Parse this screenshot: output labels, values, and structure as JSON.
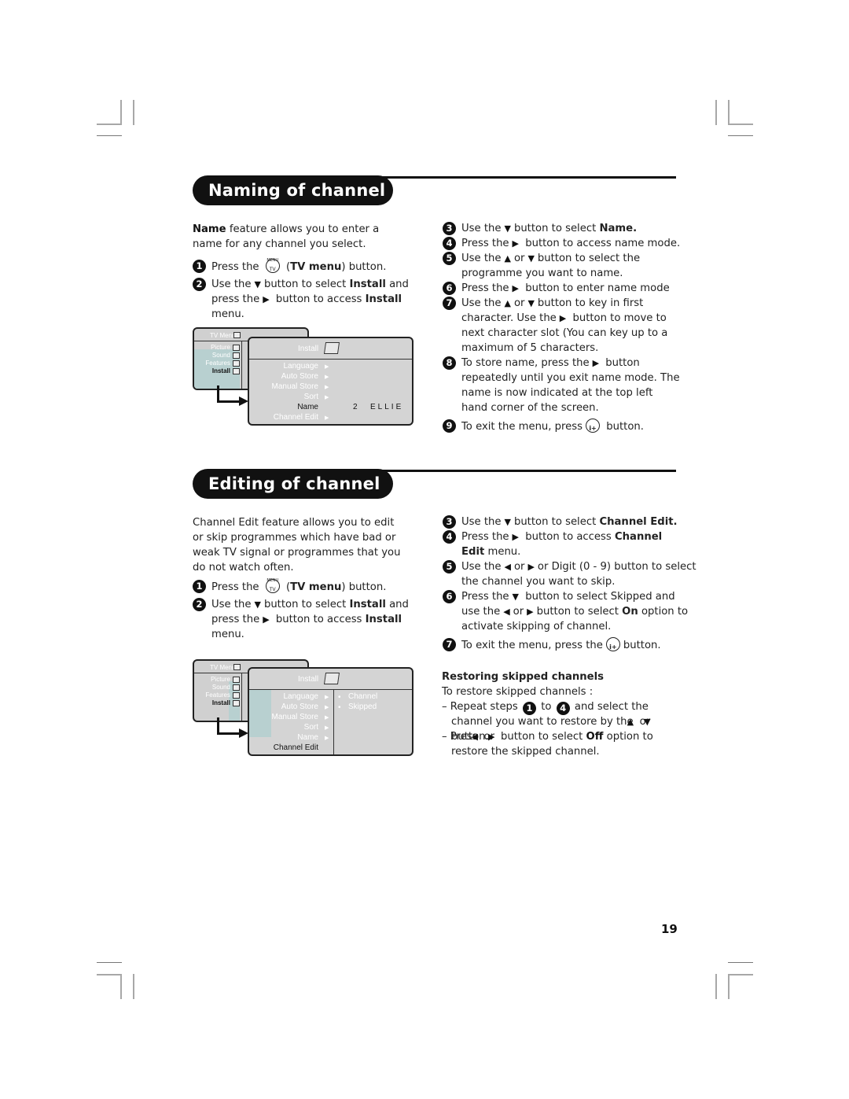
{
  "page_number": "19",
  "naming": {
    "title": "Naming of channel",
    "intro_bold": "Name",
    "intro_rest": " feature allows you to enter a name for any channel you select.",
    "step1": {
      "num": "1",
      "pre": "Press the",
      "bold": "TV menu",
      "post": "button."
    },
    "step2": {
      "num": "2",
      "a": "Use the",
      "b": "button to select",
      "c": "Install",
      "d": "and press the",
      "e": "button to access",
      "f": "Install",
      "g": "menu."
    },
    "step3": {
      "num": "3",
      "a": "Use the",
      "b": "button to select",
      "c": "Name."
    },
    "step4": {
      "num": "4",
      "a": "Press the",
      "b": "button to access name mode."
    },
    "step5": {
      "num": "5",
      "a": "Use the",
      "b": "or",
      "c": "button to select the programme you want to name."
    },
    "step6": {
      "num": "6",
      "a": "Press the",
      "b": "button to enter name mode"
    },
    "step7": {
      "num": "7",
      "a": "Use the",
      "b": "or",
      "c": "button to key in first character. Use the",
      "d": "button to move to next character slot (You can key up to a maximum of 5 characters."
    },
    "step8": {
      "num": "8",
      "a": "To store name, press the",
      "b": "button repeatedly until you exit name mode. The name is now indicated at the top left hand corner of the screen."
    },
    "step9": {
      "num": "9",
      "a": "To exit the menu, press",
      "b": "button."
    },
    "menu": {
      "tv_menu_title": "TV Menu",
      "tv_menu_items": [
        "Picture",
        "Sound",
        "Features",
        "Install"
      ],
      "install_title": "Install",
      "install_items": [
        "Language",
        "Auto Store",
        "Manual Store",
        "Sort",
        "Name",
        "Channel Edit"
      ],
      "name_program": "2",
      "name_value": "ELLIE"
    }
  },
  "editing": {
    "title": "Editing of channel",
    "intro": "Channel Edit feature allows you to edit or skip programmes which have bad or weak TV signal or programmes that you do not watch often.",
    "step1": {
      "num": "1",
      "pre": "Press the",
      "bold": "TV menu",
      "post": "button."
    },
    "step2": {
      "num": "2",
      "a": "Use the",
      "b": "button to select",
      "c": "Install",
      "d": "and press the",
      "e": "button to access",
      "f": "Install",
      "g": "menu."
    },
    "step3": {
      "num": "3",
      "a": "Use the",
      "b": "button to select",
      "c": "Channel Edit."
    },
    "step4": {
      "num": "4",
      "a": "Press the",
      "b": "button to access",
      "c": "Channel Edit",
      "d": "menu."
    },
    "step5": {
      "num": "5",
      "a": "Use the",
      "b": "or",
      "c": "or Digit (0 - 9) button to select the channel you want to skip."
    },
    "step6": {
      "num": "6",
      "a": "Press the",
      "b": "button to select Skipped and use the",
      "c": "or",
      "d": "button to select",
      "e": "On",
      "f": "option to activate skipping of channel."
    },
    "step7": {
      "num": "7",
      "a": "To exit the menu, press the",
      "b": "button."
    },
    "restore": {
      "heading": "Restoring skipped channels",
      "intro": "To restore skipped channels :",
      "b1": {
        "a": "– Repeat steps",
        "n1": "1",
        "b": "to",
        "n2": "4",
        "c": "and select the channel you want to restore by the",
        "d": "or",
        "e": "button."
      },
      "b2": {
        "a": "– Press",
        "b": "or",
        "c": "button to select",
        "d": "Off",
        "e": "option to restore the skipped channel."
      }
    },
    "menu": {
      "tv_menu_title": "TV Menu",
      "tv_menu_items": [
        "Picture",
        "Sound",
        "Features",
        "Install"
      ],
      "install_title": "Install",
      "install_items": [
        "Language",
        "Auto Store",
        "Manual Store",
        "Sort",
        "Name",
        "Channel Edit"
      ],
      "sub_items": [
        "Channel",
        "Skipped"
      ]
    }
  },
  "icons": {
    "down": "▼",
    "up": "▲",
    "right": "▶",
    "left": "◀",
    "remote_menu_label": "MENU",
    "remote_tv_label": "TV",
    "remote_osd_label": "i+"
  }
}
